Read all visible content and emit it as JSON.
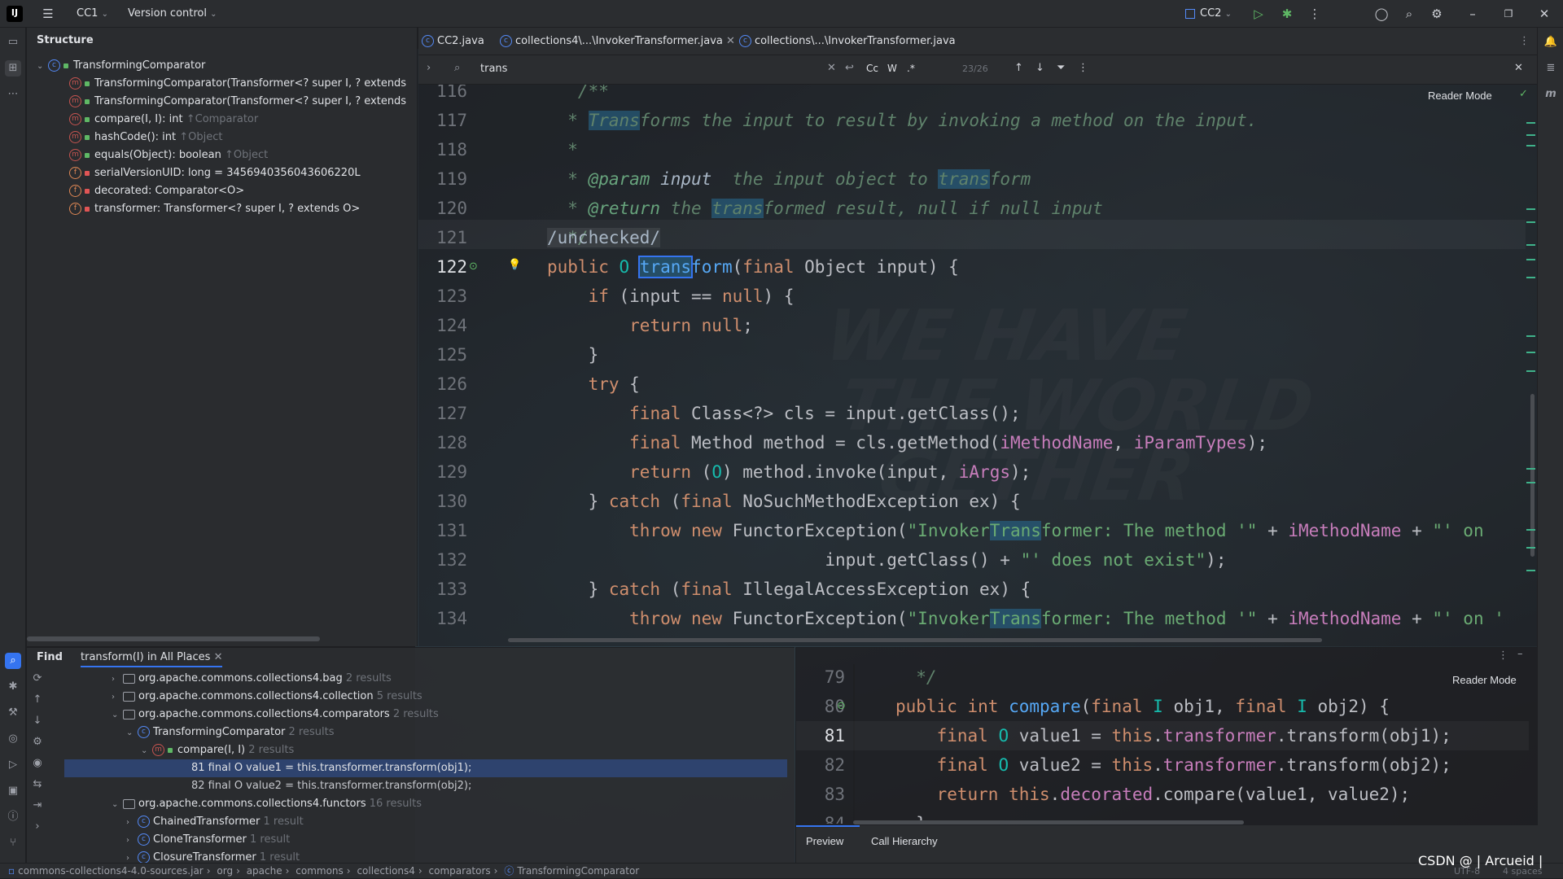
{
  "titlebar": {
    "project": "CC1",
    "vcs": "Version control",
    "run_config": "CC2"
  },
  "structure": {
    "title": "Structure",
    "root": "TransformingComparator",
    "items": [
      {
        "kind": "m",
        "text": "TransformingComparator(Transformer<? super I, ? extends",
        "inherit": ""
      },
      {
        "kind": "m",
        "text": "TransformingComparator(Transformer<? super I, ? extends",
        "inherit": ""
      },
      {
        "kind": "m",
        "text": "compare(I, I): int",
        "inherit": "↑Comparator"
      },
      {
        "kind": "m",
        "text": "hashCode(): int",
        "inherit": "↑Object"
      },
      {
        "kind": "m",
        "text": "equals(Object): boolean",
        "inherit": "↑Object"
      },
      {
        "kind": "f",
        "text": "serialVersionUID: long = 3456940356043606220L",
        "inherit": ""
      },
      {
        "kind": "f",
        "text": "decorated: Comparator<O>",
        "inherit": ""
      },
      {
        "kind": "f",
        "text": "transformer: Transformer<? super I, ? extends O>",
        "inherit": ""
      }
    ]
  },
  "tabs": [
    {
      "label": "CC2.java"
    },
    {
      "label": "collections4\\...\\InvokerTransformer.java"
    },
    {
      "label": "collections\\...\\InvokerTransformer.java"
    }
  ],
  "search": {
    "query": "trans",
    "count": "23/26",
    "cc": "Cc",
    "w": "W",
    "regex": ".*"
  },
  "editor": {
    "reader_mode": "Reader Mode",
    "watermark": "WE HAVE\n THE WORLD\n   GETHER",
    "line_numbers": [
      "116",
      "117",
      "118",
      "119",
      "120",
      "121",
      "122",
      "123",
      "124",
      "125",
      "126",
      "127",
      "128",
      "129",
      "130",
      "131",
      "132",
      "133",
      "134"
    ]
  },
  "find_panel": {
    "tab_find": "Find",
    "tab_query": "transform(I) in All Places",
    "rows": [
      {
        "label": "org.apache.commons.collections4.bag",
        "count": "2 results"
      },
      {
        "label": "org.apache.commons.collections4.collection",
        "count": "5 results"
      },
      {
        "label": "org.apache.commons.collections4.comparators",
        "count": "2 results"
      },
      {
        "label": "TransformingComparator",
        "count": "2 results"
      },
      {
        "label": "compare(I, I)",
        "count": "2 results"
      },
      {
        "label": "81 final O value1 = this.transformer.transform(obj1);",
        "count": ""
      },
      {
        "label": "82 final O value2 = this.transformer.transform(obj2);",
        "count": ""
      },
      {
        "label": "org.apache.commons.collections4.functors",
        "count": "16 results"
      },
      {
        "label": "ChainedTransformer",
        "count": "1 result"
      },
      {
        "label": "CloneTransformer",
        "count": "1 result"
      },
      {
        "label": "ClosureTransformer",
        "count": "1 result"
      }
    ]
  },
  "preview": {
    "reader_mode": "Reader Mode",
    "line_numbers": [
      "79",
      "80",
      "81",
      "82",
      "83",
      "84"
    ],
    "tab_preview": "Preview",
    "tab_hierarchy": "Call Hierarchy"
  },
  "statusbar": {
    "crumbs": [
      "commons-collections4-4.0-sources.jar",
      "org",
      "apache",
      "commons",
      "collections4",
      "comparators",
      "TransformingComparator"
    ],
    "credit": "CSDN @ | Arcueid |",
    "encoding": "UTF-8",
    "indent": "4 spaces"
  }
}
